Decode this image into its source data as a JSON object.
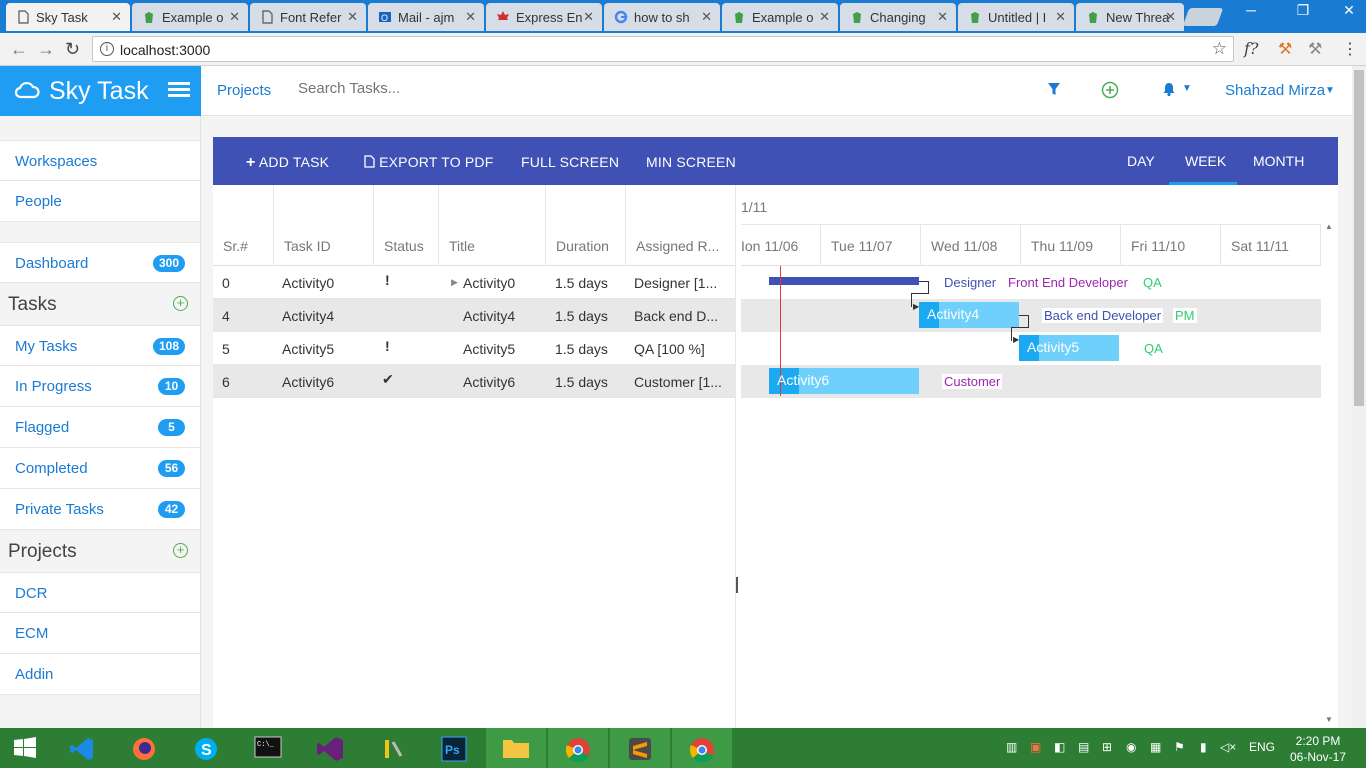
{
  "browser": {
    "tabs": [
      {
        "title": "Sky Task",
        "active": true
      },
      {
        "title": "Example o",
        "active": false
      },
      {
        "title": "Font Refer",
        "active": false
      },
      {
        "title": "Mail - ajm",
        "active": false
      },
      {
        "title": "Express En",
        "active": false
      },
      {
        "title": "how to sh",
        "active": false
      },
      {
        "title": "Example o",
        "active": false
      },
      {
        "title": "Changing",
        "active": false
      },
      {
        "title": "Untitled | I",
        "active": false
      },
      {
        "title": "New Threa",
        "active": false
      }
    ],
    "url": "localhost:3000",
    "ext_label": "f?"
  },
  "app": {
    "brand": "Sky Task",
    "nav_projects": "Projects",
    "search_placeholder": "Search Tasks...",
    "user": "Shahzad Mirza"
  },
  "sidebar": {
    "group1": [
      {
        "label": "Workspaces"
      },
      {
        "label": "People"
      }
    ],
    "dashboard": {
      "label": "Dashboard",
      "badge": "300"
    },
    "tasks_header": "Tasks",
    "tasks": [
      {
        "label": "My Tasks",
        "badge": "108"
      },
      {
        "label": "In Progress",
        "badge": "10"
      },
      {
        "label": "Flagged",
        "badge": "5"
      },
      {
        "label": "Completed",
        "badge": "56"
      },
      {
        "label": "Private Tasks",
        "badge": "42"
      }
    ],
    "projects_header": "Projects",
    "projects": [
      {
        "label": "DCR"
      },
      {
        "label": "ECM"
      },
      {
        "label": "Addin"
      }
    ]
  },
  "toolbar": {
    "add_task": "ADD TASK",
    "export_pdf": "EXPORT TO PDF",
    "full_screen": "FULL SCREEN",
    "min_screen": "MIN SCREEN",
    "day": "DAY",
    "week": "WEEK",
    "month": "MONTH",
    "active_view": "WEEK"
  },
  "grid": {
    "columns": [
      "Sr.#",
      "Task ID",
      "Status",
      "Title",
      "Duration",
      "Assigned R..."
    ],
    "rows": [
      {
        "sr": "0",
        "task_id": "Activity0",
        "status": "!",
        "title": "Activity0",
        "duration": "1.5 days",
        "assigned": "Designer [1..."
      },
      {
        "sr": "4",
        "task_id": "Activity4",
        "status": "",
        "title": "Activity4",
        "duration": "1.5 days",
        "assigned": "Back end D..."
      },
      {
        "sr": "5",
        "task_id": "Activity5",
        "status": "!",
        "title": "Activity5",
        "duration": "1.5 days",
        "assigned": "QA [100 %]"
      },
      {
        "sr": "6",
        "task_id": "Activity6",
        "status": "✔",
        "title": "Activity6",
        "duration": "1.5 days",
        "assigned": "Customer [1..."
      }
    ]
  },
  "timeline": {
    "top_label": "1/11",
    "days": [
      "Ion 11/06",
      "Tue 11/07",
      "Wed 11/08",
      "Thu 11/09",
      "Fri 11/10",
      "Sat 11/11"
    ],
    "bars": [
      {
        "label": "Activity4"
      },
      {
        "label": "Activity5"
      },
      {
        "label": "Activity6"
      }
    ],
    "resources": {
      "row0": [
        "Designer",
        "Front End Developer",
        "QA"
      ],
      "row1": [
        "Back end Developer",
        "PM"
      ],
      "row2": [
        "QA"
      ],
      "row3": [
        "Customer"
      ]
    },
    "colors": {
      "designer": "#3f51b5",
      "frontend": "#9c27b0",
      "qa": "#2ecc71",
      "backend": "#3f51b5",
      "pm": "#2ecc71",
      "customer": "#9c27b0"
    }
  },
  "taskbar": {
    "lang": "ENG",
    "time": "2:20 PM",
    "date": "06-Nov-17"
  }
}
